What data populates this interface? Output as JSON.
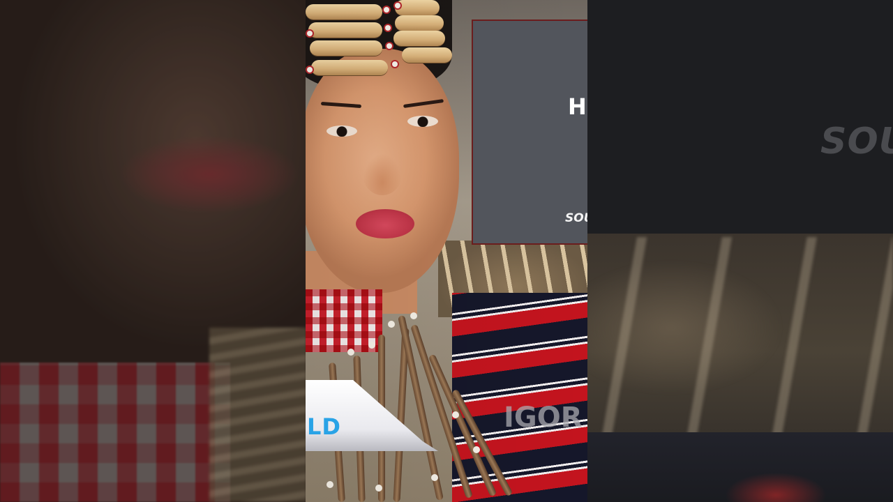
{
  "overlay": {
    "title_fragment": "H",
    "subtitle_fragment": "SOU",
    "right_ghost_text": "SOU",
    "tag_text": "LD",
    "watermark_text": "IGOR"
  },
  "colors": {
    "title_card_bg": "#52555c",
    "title_card_border": "#6b1d1d",
    "right_card_bg": "#1d1e21",
    "tag_text": "#29a3e6"
  }
}
